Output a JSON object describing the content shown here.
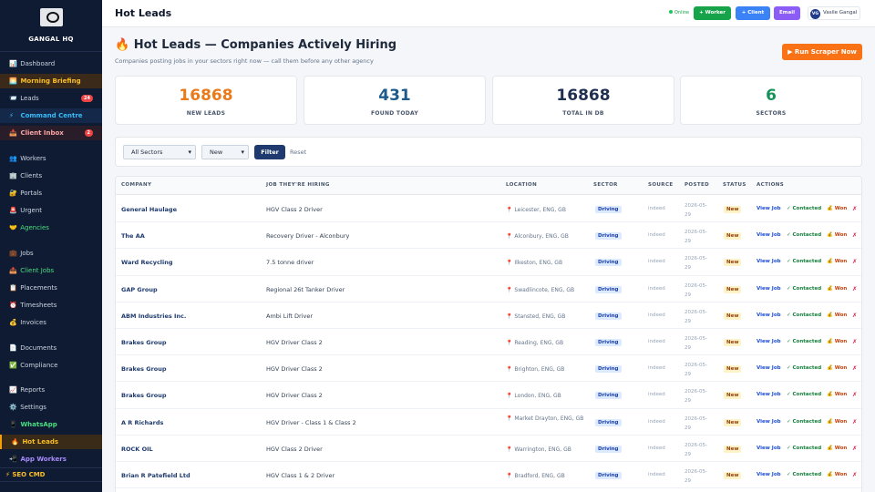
{
  "sidebar": {
    "brand": "GANGAL HQ",
    "items": [
      {
        "icon": "📊",
        "label": "Dashboard"
      },
      {
        "icon": "🌅",
        "label": "Morning Briefing"
      },
      {
        "icon": "📨",
        "label": "Leads",
        "badge": "24"
      },
      {
        "icon": "⚡",
        "label": "Command Centre"
      },
      {
        "icon": "📥",
        "label": "Client Inbox",
        "badge": "2"
      },
      {
        "icon": "👥",
        "label": "Workers"
      },
      {
        "icon": "🏢",
        "label": "Clients"
      },
      {
        "icon": "🔐",
        "label": "Portals"
      },
      {
        "icon": "🚨",
        "label": "Urgent"
      },
      {
        "icon": "🤝",
        "label": "Agencies"
      },
      {
        "icon": "💼",
        "label": "Jobs"
      },
      {
        "icon": "📤",
        "label": "Client Jobs"
      },
      {
        "icon": "📋",
        "label": "Placements"
      },
      {
        "icon": "⏰",
        "label": "Timesheets"
      },
      {
        "icon": "💰",
        "label": "Invoices"
      },
      {
        "icon": "📄",
        "label": "Documents"
      },
      {
        "icon": "✅",
        "label": "Compliance"
      },
      {
        "icon": "📈",
        "label": "Reports"
      },
      {
        "icon": "⚙️",
        "label": "Settings"
      },
      {
        "icon": "📱",
        "label": "WhatsApp"
      },
      {
        "icon": "🔥",
        "label": "Hot Leads"
      },
      {
        "icon": "📲",
        "label": "App Workers"
      }
    ],
    "footer": "⚡ SEO CMD"
  },
  "topbar": {
    "title": "Hot Leads",
    "status": "Online",
    "btn_worker": "+ Worker",
    "btn_client": "+ Client",
    "btn_email": "Email",
    "user_initials": "VG",
    "user_name": "Vasile Gangal"
  },
  "header": {
    "title": "🔥 Hot Leads — Companies Actively Hiring",
    "subtitle": "Companies posting jobs in your sectors right now — call them before any other agency",
    "run_button": "▶ Run Scraper Now"
  },
  "stats": [
    {
      "value": "16868",
      "label": "NEW LEADS",
      "color": "#ea7a1a"
    },
    {
      "value": "431",
      "label": "FOUND TODAY",
      "color": "#1e5b8c"
    },
    {
      "value": "16868",
      "label": "TOTAL IN DB",
      "color": "#1e2f4f"
    },
    {
      "value": "6",
      "label": "SECTORS",
      "color": "#15935a"
    }
  ],
  "filters": {
    "sector_value": "All Sectors",
    "status_value": "New",
    "filter_label": "Filter",
    "reset_label": "Reset"
  },
  "table": {
    "columns": [
      "COMPANY",
      "JOB THEY'RE HIRING",
      "LOCATION",
      "SECTOR",
      "SOURCE",
      "POSTED",
      "STATUS",
      "ACTIONS"
    ],
    "action_view": "View Job",
    "action_contacted": "✓ Contacted",
    "action_won": "💰 Won",
    "action_dismiss": "✗",
    "rows": [
      {
        "company": "General Haulage",
        "job": "HGV Class 2 Driver",
        "location": "Leicester, ENG, GB",
        "sector": "Driving",
        "source": "indeed",
        "posted": "2026-05-29",
        "status": "New"
      },
      {
        "company": "The AA",
        "job": "Recovery Driver - Alconbury",
        "location": "Alconbury, ENG, GB",
        "sector": "Driving",
        "source": "indeed",
        "posted": "2026-05-29",
        "status": "New"
      },
      {
        "company": "Ward Recycling",
        "job": "7.5 tonne driver",
        "location": "Ilkeston, ENG, GB",
        "sector": "Driving",
        "source": "indeed",
        "posted": "2026-05-29",
        "status": "New"
      },
      {
        "company": "GAP Group",
        "job": "Regional 26t Tanker Driver",
        "location": "Swadlincote, ENG, GB",
        "sector": "Driving",
        "source": "indeed",
        "posted": "2026-05-29",
        "status": "New"
      },
      {
        "company": "ABM Industries Inc.",
        "job": "Ambi Lift Driver",
        "location": "Stansted, ENG, GB",
        "sector": "Driving",
        "source": "indeed",
        "posted": "2026-05-29",
        "status": "New"
      },
      {
        "company": "Brakes Group",
        "job": "HGV Driver Class 2",
        "location": "Reading, ENG, GB",
        "sector": "Driving",
        "source": "indeed",
        "posted": "2026-05-29",
        "status": "New"
      },
      {
        "company": "Brakes Group",
        "job": "HGV Driver Class 2",
        "location": "Brighton, ENG, GB",
        "sector": "Driving",
        "source": "indeed",
        "posted": "2026-05-29",
        "status": "New"
      },
      {
        "company": "Brakes Group",
        "job": "HGV Driver Class 2",
        "location": "London, ENG, GB",
        "sector": "Driving",
        "source": "indeed",
        "posted": "2026-05-29",
        "status": "New"
      },
      {
        "company": "A R Richards",
        "job": "HGV Driver - Class 1 & Class 2",
        "location": "Market Drayton, ENG, GB",
        "sector": "Driving",
        "source": "indeed",
        "posted": "2026-05-29",
        "status": "New"
      },
      {
        "company": "ROCK OIL",
        "job": "HGV Class 2 Driver",
        "location": "Warrington, ENG, GB",
        "sector": "Driving",
        "source": "indeed",
        "posted": "2026-05-29",
        "status": "New"
      },
      {
        "company": "Brian R Patefield Ltd",
        "job": "HGV Class 1 & 2 Driver",
        "location": "Bradford, ENG, GB",
        "sector": "Driving",
        "source": "indeed",
        "posted": "2026-05-29",
        "status": "New"
      }
    ]
  }
}
